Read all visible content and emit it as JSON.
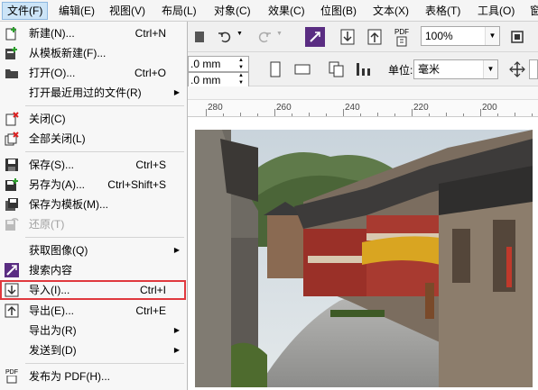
{
  "menubar": {
    "items": [
      {
        "label": "文件(F)",
        "active": true
      },
      {
        "label": "编辑(E)"
      },
      {
        "label": "视图(V)"
      },
      {
        "label": "布局(L)"
      },
      {
        "label": "对象(C)"
      },
      {
        "label": "效果(C)"
      },
      {
        "label": "位图(B)"
      },
      {
        "label": "文本(X)"
      },
      {
        "label": "表格(T)"
      },
      {
        "label": "工具(O)"
      },
      {
        "label": "窗"
      }
    ]
  },
  "toolbar": {
    "zoom_value": "100%",
    "width_value": ".0 mm",
    "height_value": ".0 mm",
    "units_label": "单位:",
    "units_value": "毫米",
    "pdf_label": "PDF"
  },
  "ruler": {
    "ticks": [
      "280",
      "260",
      "240",
      "220",
      "200"
    ]
  },
  "file_menu": {
    "items": [
      {
        "label": "新建(N)...",
        "shortcut": "Ctrl+N",
        "icon": "new-document-icon"
      },
      {
        "label": "从模板新建(F)...",
        "shortcut": "",
        "icon": "new-from-template-icon"
      },
      {
        "label": "打开(O)...",
        "shortcut": "Ctrl+O",
        "icon": "open-folder-icon"
      },
      {
        "label": "打开最近用过的文件(R)",
        "shortcut": "",
        "icon": "",
        "submenu": true
      },
      {
        "label": "关闭(C)",
        "shortcut": "",
        "icon": "close-document-icon"
      },
      {
        "label": "全部关闭(L)",
        "shortcut": "",
        "icon": "close-all-icon"
      },
      {
        "label": "保存(S)...",
        "shortcut": "Ctrl+S",
        "icon": "save-icon"
      },
      {
        "label": "另存为(A)...",
        "shortcut": "Ctrl+Shift+S",
        "icon": "save-as-icon"
      },
      {
        "label": "保存为模板(M)...",
        "shortcut": "",
        "icon": "save-template-icon"
      },
      {
        "label": "还原(T)",
        "shortcut": "",
        "icon": "revert-icon",
        "disabled": true
      },
      {
        "label": "获取图像(Q)",
        "shortcut": "",
        "icon": "",
        "submenu": true
      },
      {
        "label": "搜索内容",
        "shortcut": "",
        "icon": "search-content-icon"
      },
      {
        "label": "导入(I)...",
        "shortcut": "Ctrl+I",
        "icon": "import-icon",
        "highlighted": true
      },
      {
        "label": "导出(E)...",
        "shortcut": "Ctrl+E",
        "icon": "export-icon"
      },
      {
        "label": "导出为(R)",
        "shortcut": "",
        "icon": "",
        "submenu": true
      },
      {
        "label": "发送到(D)",
        "shortcut": "",
        "icon": "",
        "submenu": true
      },
      {
        "label": "发布为 PDF(H)...",
        "shortcut": "",
        "icon": "pdf-icon"
      }
    ]
  },
  "colors": {
    "highlight_border": "#e0393e",
    "menu_active": "#cce4f7",
    "icon_accent": "#5a2d82"
  }
}
